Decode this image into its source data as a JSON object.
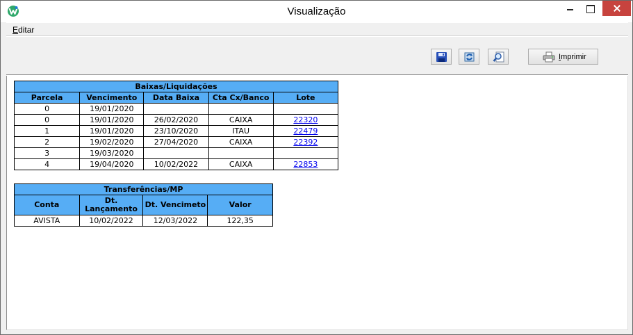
{
  "window": {
    "title": "Visualização"
  },
  "menu": {
    "items": [
      {
        "label_ul": "E",
        "label_rest": "ditar"
      }
    ]
  },
  "toolbar": {
    "save_icon": "floppy-disk-icon",
    "refresh_icon": "refresh-icon",
    "preview_icon": "magnifier-preview-icon",
    "print_label_ul": "I",
    "print_label_rest": "mprimir"
  },
  "baixas": {
    "title": "Baixas/Liquidações",
    "headers": [
      "Parcela",
      "Vencimento",
      "Data Baixa",
      "Cta Cx/Banco",
      "Lote"
    ],
    "rows": [
      [
        "0",
        "19/01/2020",
        "",
        "",
        ""
      ],
      [
        "0",
        "19/01/2020",
        "26/02/2020",
        "CAIXA",
        "22320"
      ],
      [
        "1",
        "19/01/2020",
        "23/10/2020",
        "ITAU",
        "22479"
      ],
      [
        "2",
        "19/02/2020",
        "27/04/2020",
        "CAIXA",
        "22392"
      ],
      [
        "3",
        "19/03/2020",
        "",
        "",
        ""
      ],
      [
        "4",
        "19/04/2020",
        "10/02/2022",
        "CAIXA",
        "22853"
      ]
    ]
  },
  "transferencias": {
    "title": "Transferências/MP",
    "headers": [
      "Conta",
      "Dt.\nLançamento",
      "Dt. Vencimeto",
      "Valor"
    ],
    "header_line1": "Dt.",
    "header_line2": "Lançamento",
    "rows": [
      [
        "AVISTA",
        "10/02/2022",
        "12/03/2022",
        "122,35"
      ]
    ]
  }
}
